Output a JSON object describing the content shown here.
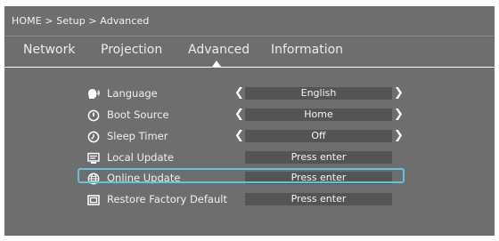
{
  "breadcrumb": "HOME > Setup > Advanced",
  "tabs": [
    "Network",
    "Projection",
    "Advanced",
    "Information"
  ],
  "active_tab": "Advanced",
  "items": [
    {
      "label": "Language",
      "value": "English",
      "icon": "speaking-head-icon",
      "arrows": true
    },
    {
      "label": "Boot Source",
      "value": "Home",
      "icon": "power-icon",
      "arrows": true
    },
    {
      "label": "Sleep Timer",
      "value": "Off",
      "icon": "clock-icon",
      "arrows": true
    },
    {
      "label": "Local Update",
      "value": "Press enter",
      "icon": "local-update-icon",
      "arrows": false
    },
    {
      "label": "Online Update",
      "value": "Press enter",
      "icon": "globe-icon",
      "arrows": false,
      "selected": true
    },
    {
      "label": "Restore Factory Default",
      "value": "Press enter",
      "icon": "restore-icon",
      "arrows": false
    }
  ],
  "colors": {
    "background": "#6e6e6e",
    "value_box": "#545454",
    "selection": "#5cc6dd",
    "text": "#f2f2f2"
  }
}
